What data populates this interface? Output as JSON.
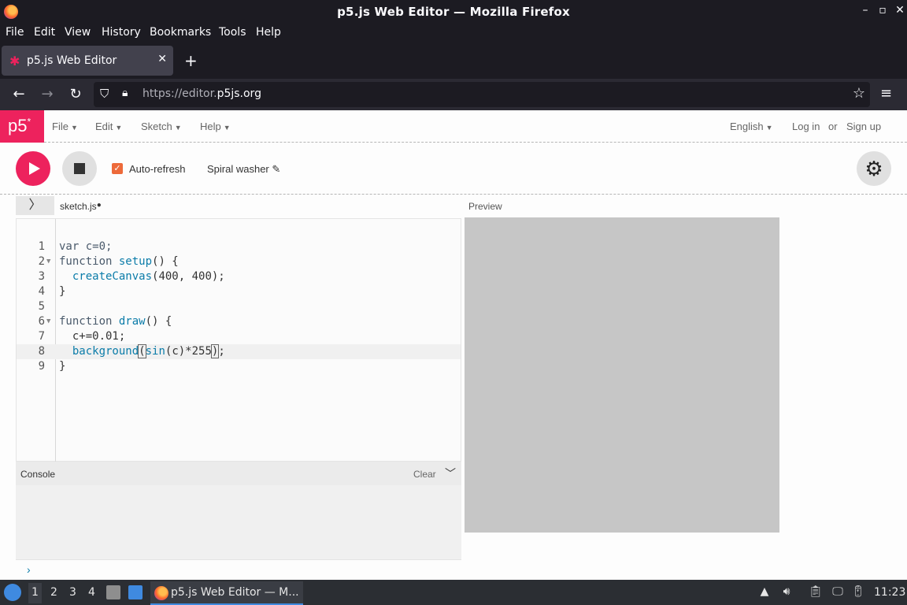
{
  "window": {
    "title": "p5.js Web Editor — Mozilla Firefox",
    "controls": [
      "–",
      "▫",
      "✕"
    ]
  },
  "menubar": [
    "File",
    "Edit",
    "View",
    "History",
    "Bookmarks",
    "Tools",
    "Help"
  ],
  "tab": {
    "label": "p5.js Web Editor",
    "close": "✕",
    "new": "+"
  },
  "nav": {
    "url_prefix": "https://editor.",
    "url_domain": "p5js.org"
  },
  "app": {
    "logo": "p5",
    "logo_mark": "*",
    "menus": [
      "File",
      "Edit",
      "Sketch",
      "Help"
    ],
    "language": "English",
    "login": "Log in",
    "or": "or",
    "signup": "Sign up",
    "autorefresh_label": "Auto-refresh",
    "autorefresh_checked": true,
    "sketch_name": "Spiral washer ✎",
    "file_tab": "sketch.js",
    "unsaved_dot": "●",
    "preview_label": "Preview",
    "console_label": "Console",
    "console_clear": "Clear",
    "console_prompt": "›",
    "preview_color": "#c6c6c6",
    "accent": "#ed225d"
  },
  "code": {
    "line_numbers": [
      "1",
      "2",
      "3",
      "4",
      "5",
      "6",
      "7",
      "8",
      "9"
    ],
    "l1": "var c=0;",
    "l2a": "function ",
    "l2b": "setup",
    "l2c": "() {",
    "l3a": "  ",
    "l3b": "createCanvas",
    "l3c": "(400, 400);",
    "l4": "}",
    "l5": "",
    "l6a": "function ",
    "l6b": "draw",
    "l6c": "() {",
    "l7": "  c+=0.01;",
    "l8a": "  ",
    "l8b": "background",
    "l8c": "(",
    "l8d": "sin",
    "l8e": "(c)*255",
    "l8f": ")",
    "l8g": ";",
    "l9": "}"
  },
  "taskbar": {
    "workspaces": [
      "1",
      "2",
      "3",
      "4"
    ],
    "window_label": "p5.js Web Editor — M...",
    "clock": "11:23"
  }
}
